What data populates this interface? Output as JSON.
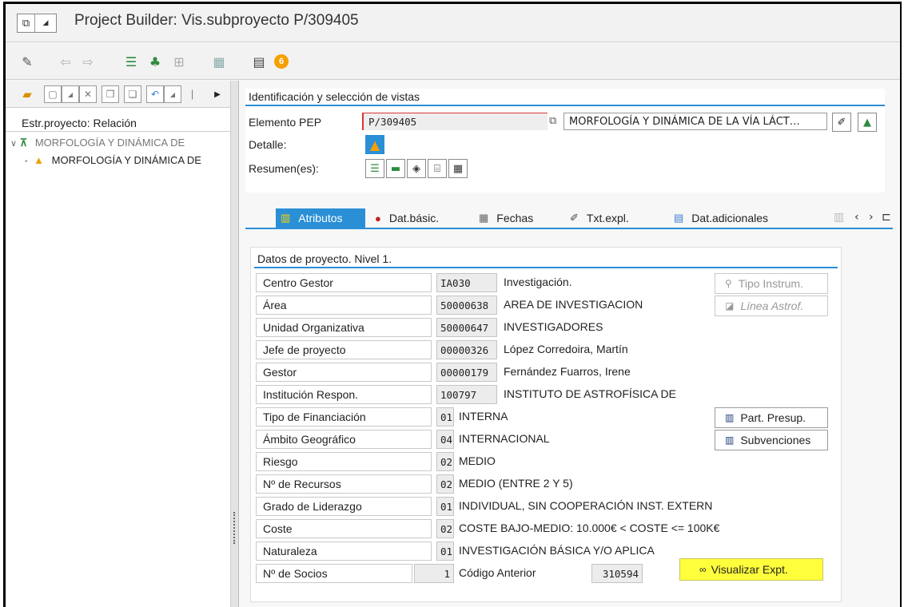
{
  "window": {
    "title": "Project Builder: Vis.subproyecto P/309405"
  },
  "toolbar": {
    "badge_count": "6"
  },
  "left": {
    "header": "Estr.proyecto: Relación",
    "tree": [
      {
        "label": "MORFOLOGÍA Y DINÁMICA DE"
      },
      {
        "label": "MORFOLOGÍA Y DINÁMICA DE"
      }
    ]
  },
  "ident": {
    "title": "Identificación y selección de vistas",
    "elemento_label": "Elemento PEP",
    "elemento_value": "P/309405",
    "elemento_desc": "MORFOLOGÍA Y DINÁMICA DE LA VÍA LÁCT…",
    "detalle_label": "Detalle:",
    "resumen_label": "Resumen(es):"
  },
  "tabs": [
    {
      "label": "Atributos"
    },
    {
      "label": "Dat.básic."
    },
    {
      "label": "Fechas"
    },
    {
      "label": "Txt.expl."
    },
    {
      "label": "Dat.adicionales"
    }
  ],
  "datos": {
    "title": "Datos de proyecto. Nivel 1.",
    "rows": [
      {
        "label": "Centro Gestor",
        "code": "IA030",
        "desc": "Investigación."
      },
      {
        "label": "Área",
        "code": "50000638",
        "desc": "AREA DE INVESTIGACION"
      },
      {
        "label": "Unidad Organizativa",
        "code": "50000647",
        "desc": "INVESTIGADORES"
      },
      {
        "label": "Jefe de proyecto",
        "code": "00000326",
        "desc": "López Corredoira, Martín"
      },
      {
        "label": "Gestor",
        "code": "00000179",
        "desc": "Fernández Fuarros, Irene"
      },
      {
        "label": "Institución Respon.",
        "code": "100797",
        "desc": "INSTITUTO DE ASTROFÍSICA DE"
      },
      {
        "label": "Tipo de Financiación",
        "code": "01",
        "desc": "INTERNA"
      },
      {
        "label": "Ámbito Geográfico",
        "code": "04",
        "desc": "INTERNACIONAL"
      },
      {
        "label": "Riesgo",
        "code": "02",
        "desc": "MEDIO"
      },
      {
        "label": "Nº de Recursos",
        "code": "02",
        "desc": "MEDIO (ENTRE 2 Y 5)"
      },
      {
        "label": "Grado de Liderazgo",
        "code": "01",
        "desc": "INDIVIDUAL, SIN COOPERACIÓN INST. EXTERN"
      },
      {
        "label": "Coste",
        "code": "02",
        "desc": "COSTE BAJO-MEDIO: 10.000€ < COSTE <= 100K€"
      },
      {
        "label": "Naturaleza",
        "code": "01",
        "desc": "INVESTIGACIÓN BÁSICA Y/O APLICA"
      }
    ],
    "socios_label": "Nº de Socios",
    "socios_value": "1",
    "codigo_label": "Código Anterior",
    "codigo_value": "310594",
    "buttons": {
      "tipo_instrum": "Tipo Instrum.",
      "linea_astrof": "Línea Astrof.",
      "part_presup": "Part. Presup.",
      "subvenciones": "Subvenciones",
      "visualizar": "Visualizar Expt."
    }
  },
  "colors": {
    "accent": "#2b8fd6",
    "highlight": "#ffff3c",
    "warning": "#f5a000"
  }
}
